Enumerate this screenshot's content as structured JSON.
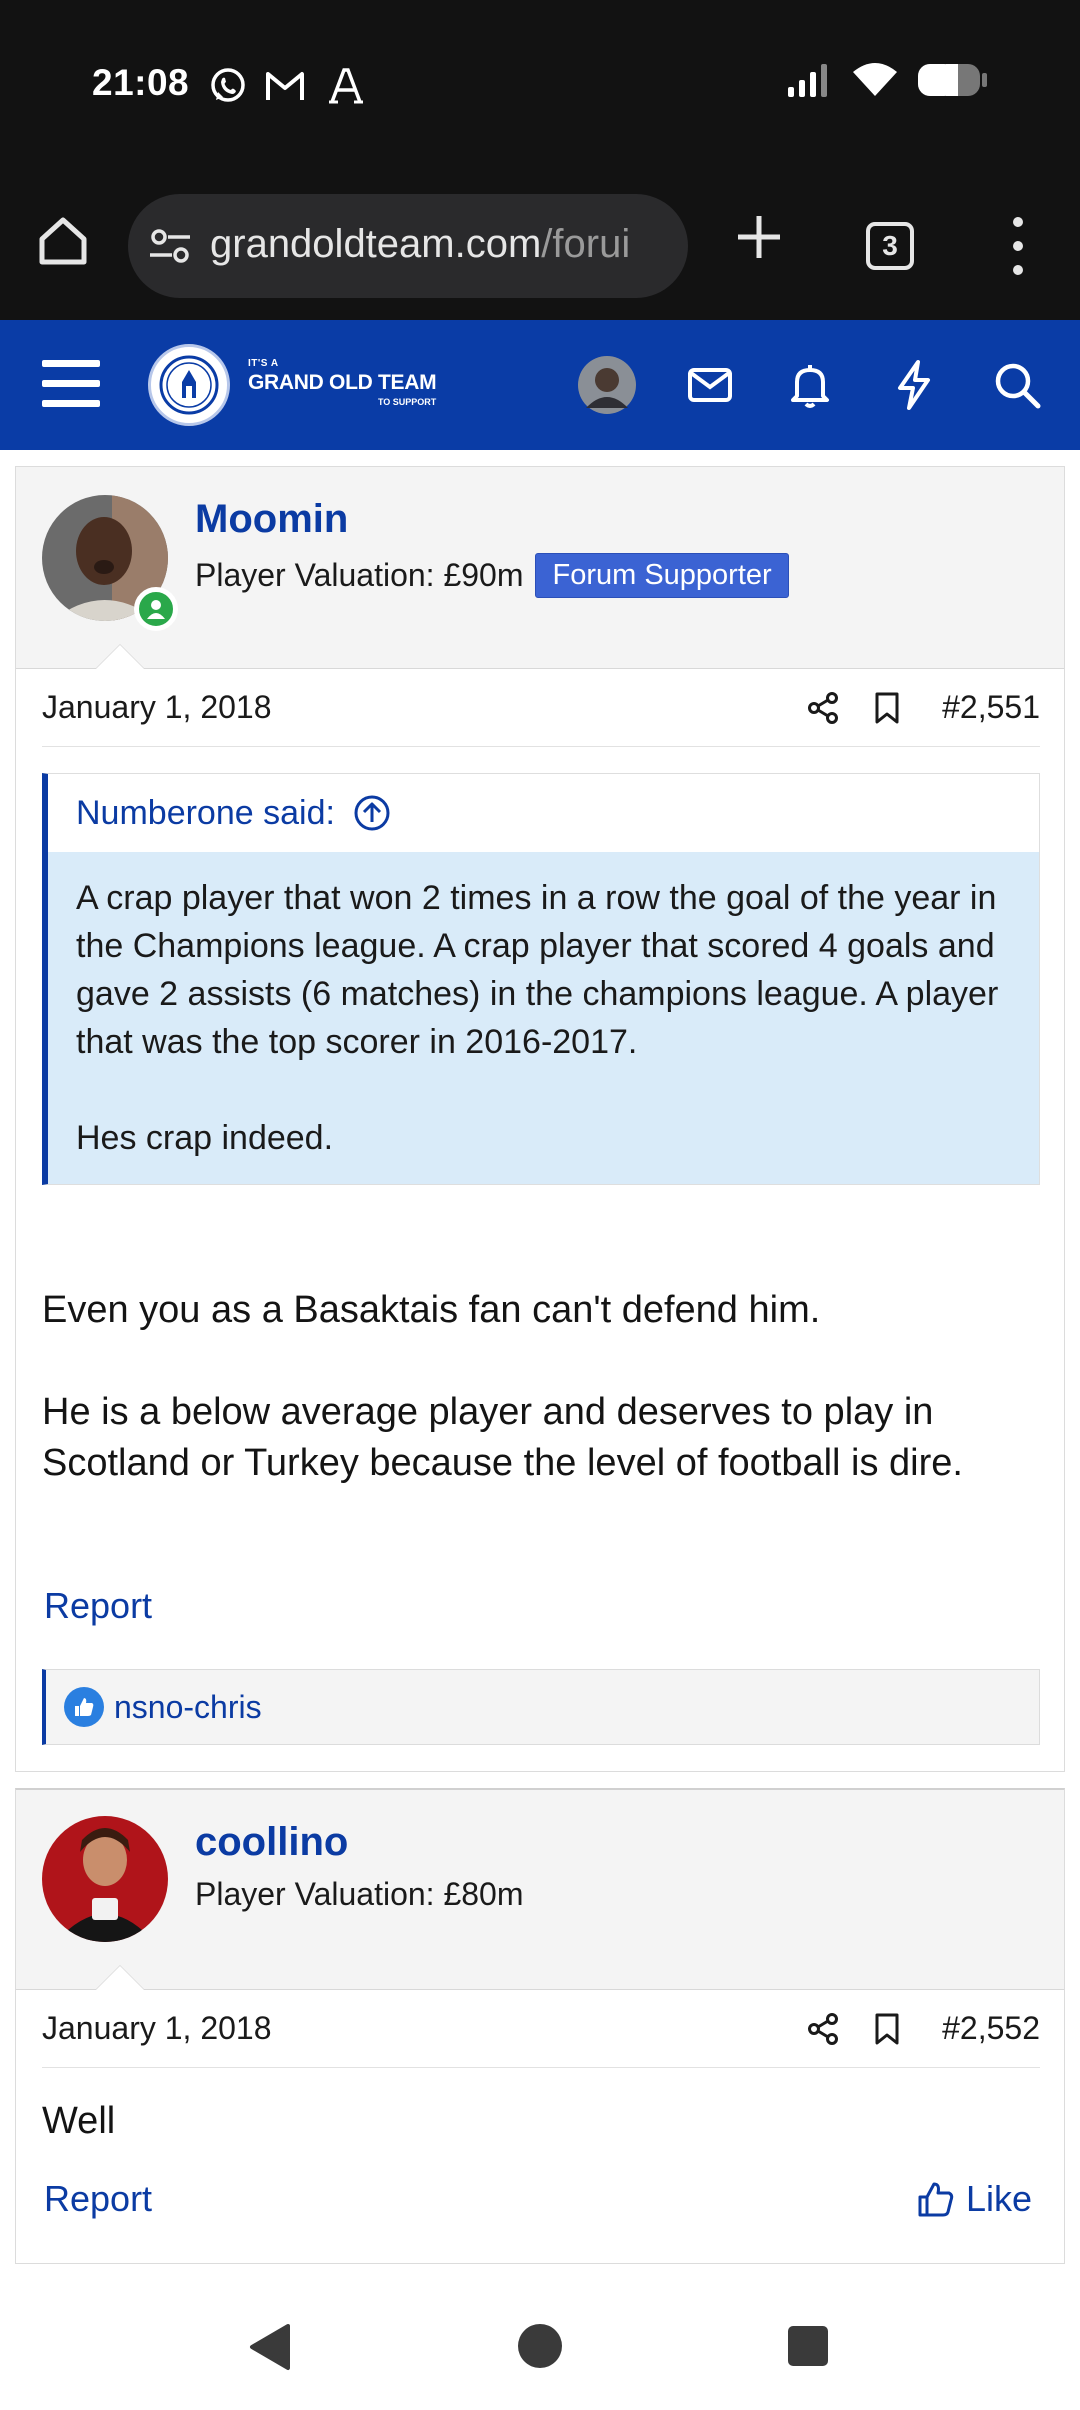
{
  "status_bar": {
    "time": "21:08"
  },
  "browser": {
    "url_main": "grandoldteam.com",
    "url_rest": "/forui",
    "tab_count": "3"
  },
  "site": {
    "logo_small": "IT'S A",
    "logo_big": "GRAND OLD TEAM",
    "logo_sub": "TO SUPPORT"
  },
  "posts": [
    {
      "username": "Moomin",
      "valuation": "Player Valuation: £90m",
      "badge": "Forum Supporter",
      "date": "January 1, 2018",
      "number": "#2,551",
      "quote": {
        "author": "Numberone said:",
        "text1": "A crap player that won 2 times in a row the goal of the year in the Champions league. A crap player that scored 4 goals and gave 2 assists (6 matches) in the champions league. A player that was the top scorer in 2016-2017.",
        "text2": "Hes crap indeed."
      },
      "message1": "Even you as a Basaktais fan can't defend him.",
      "message2": "He is a below average player and deserves to play in Scotland or Turkey because the level of football is dire.",
      "report": "Report",
      "reactions": "nsno-chris"
    },
    {
      "username": "coollino",
      "valuation": "Player Valuation: £80m",
      "date": "January 1, 2018",
      "number": "#2,552",
      "message": "Well",
      "report": "Report",
      "like": "Like"
    }
  ],
  "colors": {
    "brand_blue": "#0a3ca6",
    "link_blue": "#0b3ba3",
    "quote_bg": "#d9ebf9",
    "online_green": "#2aa84a"
  }
}
